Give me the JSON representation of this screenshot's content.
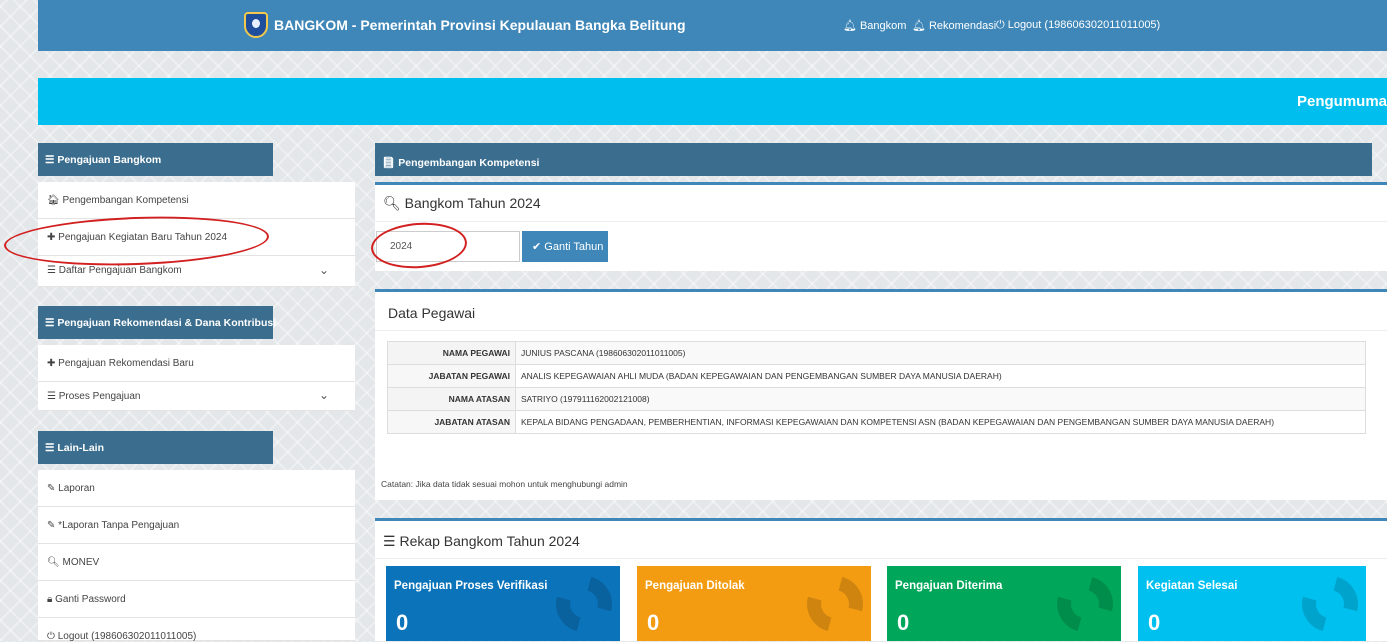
{
  "navbar": {
    "brand": "BANGKOM - Pemerintah Provinsi Kepulauan Bangka Belitung",
    "links": [
      "Bangkom",
      "Rekomendasi",
      "Logout (198606302011011005)"
    ]
  },
  "announcement": "Pengumuma",
  "sidebar": {
    "section1": {
      "title": "Pengajuan Bangkom",
      "items": [
        "Pengembangan Kompetensi",
        "Pengajuan Kegiatan Baru Tahun 2024",
        "Daftar Pengajuan Bangkom"
      ]
    },
    "section2": {
      "title": "Pengajuan Rekomendasi & Dana Kontribusi",
      "items": [
        "Pengajuan Rekomendasi Baru",
        "Proses Pengajuan"
      ]
    },
    "section3": {
      "title": "Lain-Lain",
      "items": [
        "Laporan",
        "*Laporan Tanpa Pengajuan",
        "MONEV",
        "Ganti Password",
        "Logout (198606302011011005)"
      ]
    }
  },
  "main": {
    "panel_title": "Pengembangan Kompetensi",
    "year_card": {
      "title": "Bangkom Tahun 2024",
      "year_value": "2024",
      "button": "Ganti Tahun"
    },
    "data_card": {
      "title": "Data Pegawai",
      "rows": [
        {
          "key": "NAMA PEGAWAI",
          "value": "JUNIUS PASCANA (198606302011011005)"
        },
        {
          "key": "JABATAN PEGAWAI",
          "value": "ANALIS KEPEGAWAIAN AHLI MUDA (BADAN KEPEGAWAIAN DAN PENGEMBANGAN SUMBER DAYA MANUSIA DAERAH)"
        },
        {
          "key": "NAMA ATASAN",
          "value": "SATRIYO (197911162002121008)"
        },
        {
          "key": "JABATAN ATASAN",
          "value": "KEPALA BIDANG PENGADAAN, PEMBERHENTIAN, INFORMASI KEPEGAWAIAN DAN KOMPETENSI ASN (BADAN KEPEGAWAIAN DAN PENGEMBANGAN SUMBER DAYA MANUSIA DAERAH)"
        }
      ],
      "note": "Catatan: Jika data tidak sesuai mohon untuk menghubungi admin"
    },
    "rekap": {
      "title": "Rekap Bangkom Tahun 2024",
      "boxes": [
        {
          "label": "Pengajuan Proses Verifikasi",
          "count": "0",
          "color": "#0b73b9"
        },
        {
          "label": "Pengajuan Ditolak",
          "count": "0",
          "color": "#f39c12"
        },
        {
          "label": "Pengajuan Diterima",
          "count": "0",
          "color": "#00a65a"
        },
        {
          "label": "Kegiatan Selesai",
          "count": "0",
          "color": "#00c0ef"
        }
      ]
    }
  }
}
